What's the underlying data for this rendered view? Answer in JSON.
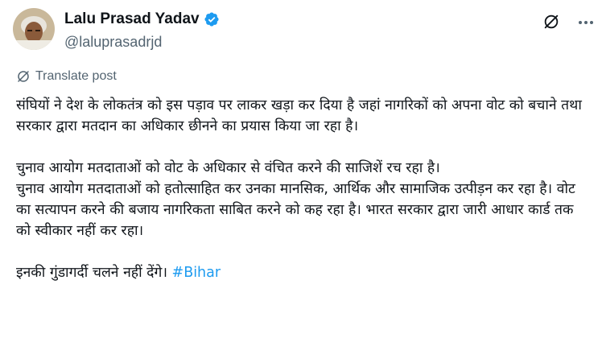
{
  "author": {
    "display_name": "Lalu Prasad Yadav",
    "handle": "@laluprasadrjd",
    "verified_icon": "verified-badge-icon",
    "avatar_icon": "avatar"
  },
  "actions": {
    "grok_icon": "grok-icon",
    "more_icon": "more-options-icon"
  },
  "translate": {
    "label": "Translate post",
    "icon": "globe-icon"
  },
  "post": {
    "para1": "संघियों ने देश के लोकतंत्र को इस पड़ाव पर लाकर खड़ा कर दिया है जहां नागरिकों को अपना वोट को बचाने तथा सरकार द्वारा मतदान का अधिकार छीनने का प्रयास किया जा रहा है।",
    "para2a": "चुनाव आयोग मतदाताओं को वोट के अधिकार से वंचित करने की साजिशें रच रहा है।",
    "para2b": "चुनाव आयोग मतदाताओं को हतोत्साहित कर उनका मानसिक, आर्थिक और सामाजिक उत्पीड़न कर रहा है। वोट का सत्यापन करने की बजाय नागरिकता साबित करने को कह रहा है। भारत सरकार द्वारा जारी आधार कार्ड तक को स्वीकार नहीं कर रहा।",
    "para3": "इनकी गुंडागर्दी चलने नहीं देंगे। ",
    "hashtag": "#Bihar"
  },
  "colors": {
    "text": "#0f1419",
    "secondary": "#536471",
    "link": "#1d9bf0",
    "verified": "#1d9bf0"
  }
}
